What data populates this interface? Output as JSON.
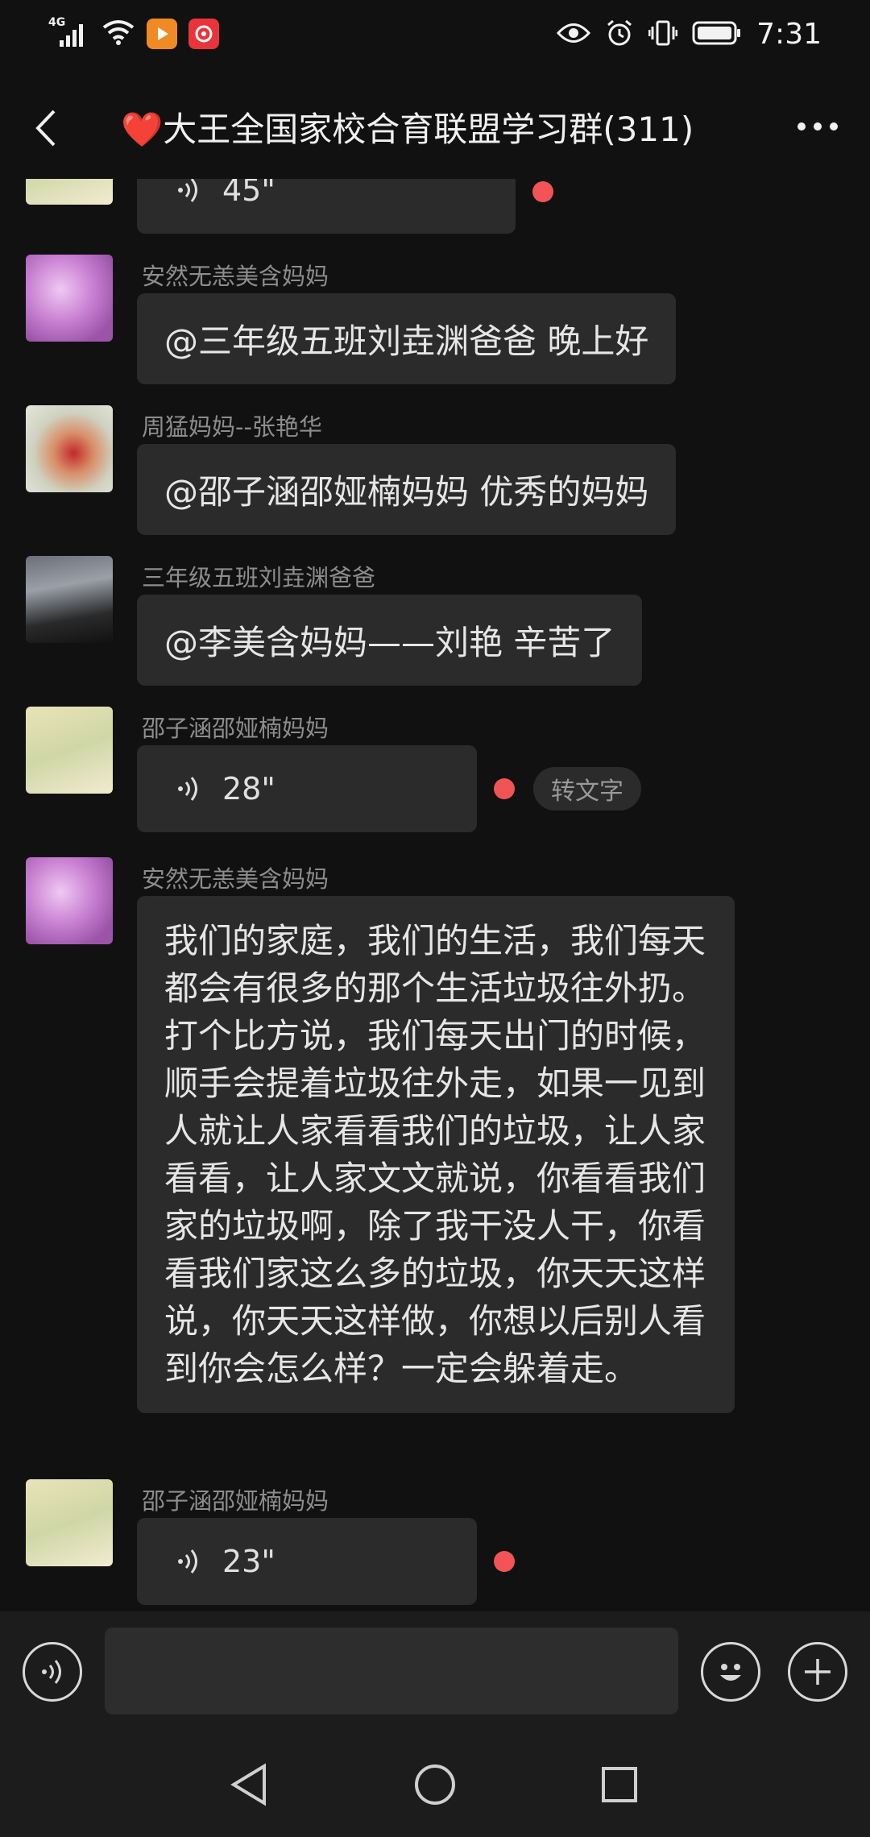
{
  "status_bar": {
    "network": "4G",
    "time": "7:31"
  },
  "header": {
    "title": "❤️大王全国家校合育联盟学习群(311)",
    "back_icon": "chevron-left-icon",
    "more_icon": "more-dots-icon"
  },
  "messages": [
    {
      "type": "voice",
      "sender": "",
      "duration": "45\"",
      "unread": true
    },
    {
      "type": "text",
      "sender": "安然无恙美含妈妈",
      "text": "@三年级五班刘垚渊爸爸  晚上好"
    },
    {
      "type": "text",
      "sender": "周猛妈妈--张艳华",
      "text": "@邵子涵邵娅楠妈妈  优秀的妈妈"
    },
    {
      "type": "text",
      "sender": "三年级五班刘垚渊爸爸",
      "text": "@李美含妈妈——刘艳  辛苦了"
    },
    {
      "type": "voice",
      "sender": "邵子涵邵娅楠妈妈",
      "duration": "28\"",
      "unread": true,
      "convert_label": "转文字"
    },
    {
      "type": "text",
      "sender": "安然无恙美含妈妈",
      "text": "我们的家庭，我们的生活，我们每天都会有很多的那个生活垃圾往外扔。打个比方说，我们每天出门的时候，顺手会提着垃圾往外走，如果一见到人就让人家看看我们的垃圾，让人家看看，让人家文文就说，你看看我们家的垃圾啊，除了我干没人干，你看看我们家这么多的垃圾，你天天这样说，你天天这样做，你想以后别人看到你会怎么样？一定会躲着走。"
    },
    {
      "type": "voice",
      "sender": "邵子涵邵娅楠妈妈",
      "duration": "23\"",
      "unread": true
    }
  ],
  "input_bar": {
    "placeholder": "",
    "voice_icon": "voice-mode-icon",
    "emoji_icon": "emoji-icon",
    "plus_icon": "plus-icon"
  },
  "nav_bar": {
    "back_icon": "nav-back-icon",
    "home_icon": "nav-home-icon",
    "recents_icon": "nav-recents-icon"
  },
  "colors": {
    "background": "#111111",
    "bubble": "#2b2b2b",
    "unread_dot": "#f25455",
    "sender_text": "#8d8d8d"
  }
}
